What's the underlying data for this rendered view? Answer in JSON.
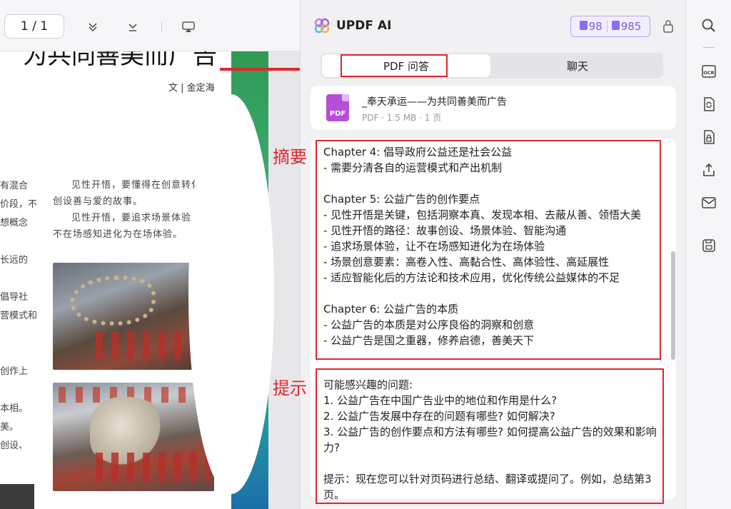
{
  "viewer": {
    "page_indicator": "1 / 1",
    "page": {
      "title": "为共同善美而广告",
      "author": "文 | 金定海",
      "left_column_lines": [
        "有混合",
        "价段，不",
        "想概念",
        "",
        "长远的",
        "",
        "倡导社",
        "营模式和",
        "",
        "",
        "创作上",
        "",
        "本相。",
        "美。",
        "创设、"
      ],
      "right_column_paragraphs": [
        "见性开悟，要懂得在创意转化中创设善与爱的故事。",
        "见性开悟，要追求场景体验，让不在场感知进化为在场体验。"
      ]
    }
  },
  "ai_panel": {
    "title": "UPDF AI",
    "credits": {
      "doc_count": "98",
      "chat_count": "985"
    },
    "tabs": [
      {
        "label": "PDF 问答"
      },
      {
        "label": "聊天"
      }
    ],
    "file": {
      "name": "_奉天承运——为共同善美而广告",
      "meta": "PDF · 1.5 MB · 1 页",
      "icon_label": "PDF"
    },
    "summary_lines": [
      "Chapter 4: 倡导政府公益还是社会公益",
      "- 需要分清各自的运营模式和产出机制",
      "",
      "Chapter 5: 公益广告的创作要点",
      "- 见性开悟是关键，包括洞察本真、发现本相、去蔽从善、领悟大美",
      "- 见性开悟的路径：故事创设、场景体验、智能沟通",
      "- 追求场景体验，让不在场感知进化为在场体验",
      "- 场景创意要素：高卷入性、高黏合性、高体验性、高延展性",
      "- 适应智能化后的方法论和技术应用，优化传统公益媒体的不足",
      "",
      "Chapter 6: 公益广告的本质",
      "- 公益广告的本质是对公序良俗的洞察和创意",
      "- 公益广告是国之重器，修养启德，善美天下"
    ],
    "prompt_lines": [
      "可能感兴趣的问题:",
      "1. 公益广告在中国广告业中的地位和作用是什么?",
      "2. 公益广告发展中存在的问题有哪些? 如何解决?",
      "3. 公益广告的创作要点和方法有哪些? 如何提高公益广告的效果和影响力?",
      "",
      "提示：现在您可以针对页码进行总结、翻译或提问了。例如，总结第3页。"
    ]
  },
  "annotations": {
    "summary_label": "摘要",
    "prompt_label": "提示",
    "color": "#e2262b"
  },
  "sidebar_icons": [
    "search-icon",
    "ocr-icon",
    "convert-icon",
    "protect-icon",
    "share-icon",
    "mail-icon",
    "save-icon"
  ],
  "colors": {
    "accent": "#7b5ce0",
    "annotation_red": "#e2262b",
    "pdf_purple": "#b64fd6"
  }
}
